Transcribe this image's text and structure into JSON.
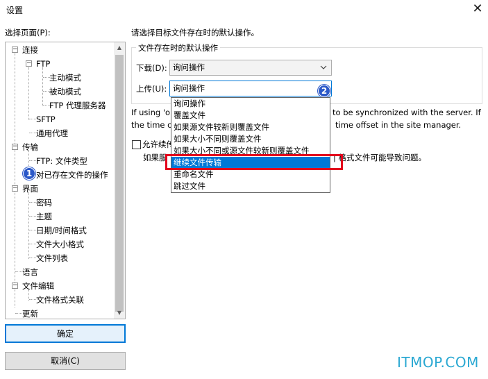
{
  "window": {
    "title": "设置",
    "close_glyph": "✕"
  },
  "nav": {
    "label": "选择页面(P):",
    "items": [
      {
        "label": "连接"
      },
      {
        "label": "FTP"
      },
      {
        "label": "主动模式"
      },
      {
        "label": "被动模式"
      },
      {
        "label": "FTP 代理服务器"
      },
      {
        "label": "SFTP"
      },
      {
        "label": "通用代理"
      },
      {
        "label": "传输"
      },
      {
        "label": "FTP: 文件类型"
      },
      {
        "label": "对已存在文件的操作"
      },
      {
        "label": "界面"
      },
      {
        "label": "密码"
      },
      {
        "label": "主题"
      },
      {
        "label": "日期/时间格式"
      },
      {
        "label": "文件大小格式"
      },
      {
        "label": "文件列表"
      },
      {
        "label": "语言"
      },
      {
        "label": "文件编辑"
      },
      {
        "label": "文件格式关联"
      },
      {
        "label": "更新"
      }
    ],
    "expander_minus": "−"
  },
  "buttons": {
    "ok": "确定",
    "cancel": "取消(C)"
  },
  "panel": {
    "instruction": "请选择目标文件存在时的默认操作。",
    "group_title": "文件存在时的默认操作",
    "download_label": "下载(D):",
    "download_value": "询问操作",
    "upload_label": "上传(U):",
    "upload_value": "询问操作",
    "info_line1_left": "If using 'o",
    "info_line1_right": "to be synchronized with the server. If",
    "info_line2_left": "the time o",
    "info_line2_right": "time offset in the site manager.",
    "checkbox_label": "允许续传",
    "info3_left": "如果服",
    "info3_right": "| 格式文件可能导致问题。"
  },
  "dropdown": {
    "options": [
      "询问操作",
      "覆盖文件",
      "如果源文件较新则覆盖文件",
      "如果大小不同则覆盖文件",
      "如果大小不同或源文件较新则覆盖文件",
      "继续文件传输",
      "重命名文件",
      "跳过文件"
    ],
    "selected_index": 5
  },
  "badges": {
    "one": "1",
    "two": "2"
  },
  "icons": {
    "chevron": "chevron-down-icon",
    "close": "close-icon",
    "scroll_up": "▲",
    "scroll_down": "▼"
  },
  "watermark": "ITMOP.COM",
  "colors": {
    "accent": "#0078d7",
    "highlight": "#e3001b",
    "badge": "#2b58c8",
    "watermark": "#2aa8d2"
  }
}
